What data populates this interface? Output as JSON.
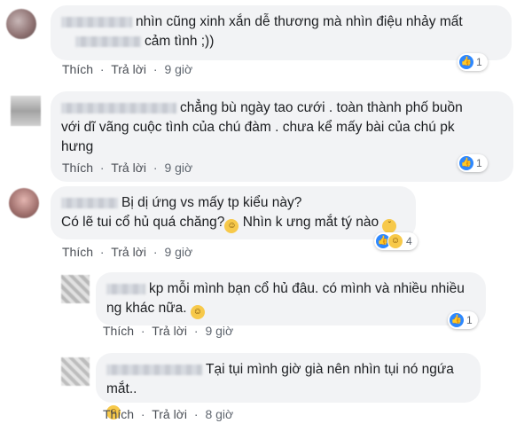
{
  "actions": {
    "like": "Thích",
    "reply": "Trả lời",
    "sep": "·"
  },
  "comments": [
    {
      "line1": "nhìn cũng xinh xắn dễ thương mà nhìn điệu nhảy mất",
      "line2": "cảm tình ;))",
      "time": "9 giờ",
      "reactions": "1"
    },
    {
      "line1": "chẳng bù ngày tao cưới . toàn thành phố buồn",
      "line2": "với dĩ vãng cuộc tình của chú đàm . chưa kể mấy bài của chú pk",
      "line3": "hưng",
      "time": "9 giờ",
      "reactions": "1"
    },
    {
      "line1": "Bị dị ứng vs mấy tp kiểu này?",
      "line2": "Có lẽ tui cổ hủ quá chăng?",
      "line2b": "Nhìn k ưng mắt tý nào",
      "time": "9 giờ",
      "reactions": "4"
    },
    {
      "line1": "kp mỗi mình bạn cổ hủ đâu. có mình và nhiều nhiều",
      "line2": "ng khác nữa.",
      "time": "9 giờ",
      "reactions": "1"
    },
    {
      "line1": "Tại tụi mình giờ già nên nhìn tụi nó ngứa mắt..",
      "time": "8 giờ"
    }
  ],
  "colors": {
    "bubble": "#f2f3f5",
    "like_blue": "#2d88ff",
    "meta_gray": "#606770"
  },
  "icons": [
    "like-icon",
    "haha-icon",
    "smile-emoji",
    "laugh-emoji",
    "confused-emoji"
  ]
}
